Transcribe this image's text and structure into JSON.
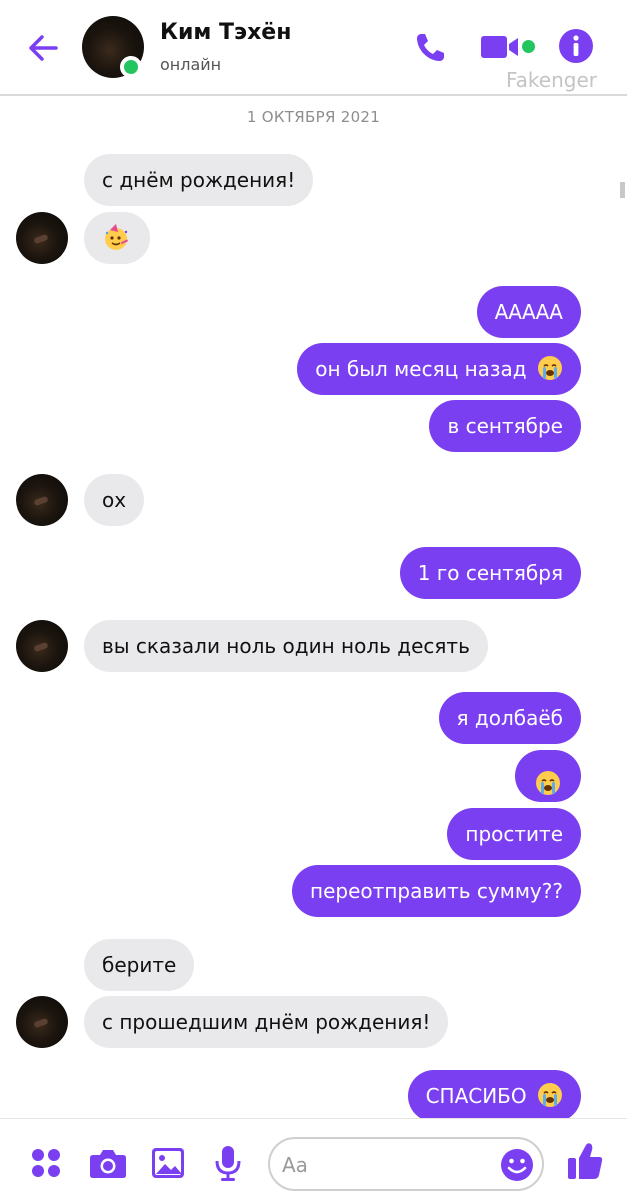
{
  "header": {
    "name": "Ким Тэхён",
    "status": "онлайн",
    "watermark": "Fakenger"
  },
  "date_separator": "1 ОКТЯБРЯ 2021",
  "messages": [
    {
      "from": "them",
      "text": "с днём рождения!"
    },
    {
      "from": "them",
      "emoji": "party-face"
    },
    {
      "from": "me",
      "text": "ААААА"
    },
    {
      "from": "me",
      "text": "он был месяц назад",
      "emoji": "loudly-crying-face"
    },
    {
      "from": "me",
      "text": "в сентябре"
    },
    {
      "from": "them",
      "text": "ох"
    },
    {
      "from": "me",
      "text": "1 го сентября"
    },
    {
      "from": "them",
      "text": "вы сказали ноль один ноль десять"
    },
    {
      "from": "me",
      "text": "я долбаёб"
    },
    {
      "from": "me",
      "emoji": "loudly-crying-face"
    },
    {
      "from": "me",
      "text": "простите"
    },
    {
      "from": "me",
      "text": "переотправить сумму??"
    },
    {
      "from": "them",
      "text": "берите"
    },
    {
      "from": "them",
      "text": "с прошедшим днём рождения!"
    },
    {
      "from": "me",
      "text": "СПАСИБО",
      "emoji": "loudly-crying-face"
    }
  ],
  "composer": {
    "placeholder": "Aa"
  },
  "icons": {
    "back": "arrow-left-icon",
    "call": "phone-icon",
    "video": "video-camera-icon",
    "info": "info-icon",
    "apps": "grid-dots-icon",
    "camera": "camera-icon",
    "gallery": "image-icon",
    "mic": "microphone-icon",
    "emoji": "smiley-icon",
    "like": "thumbs-up-icon"
  },
  "colors": {
    "accent": "#7b3ff2",
    "online": "#22c55e",
    "incoming_bubble": "#e9e9eb"
  }
}
